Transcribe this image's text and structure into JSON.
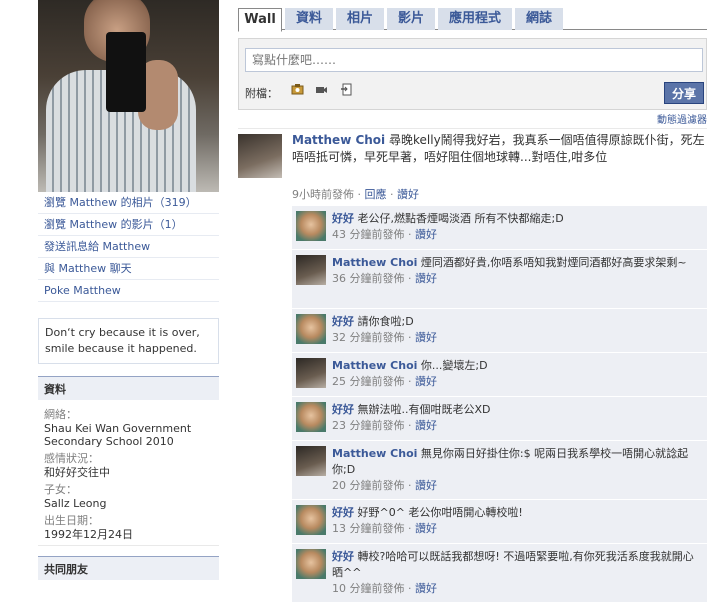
{
  "profile": {
    "links": [
      "瀏覽 Matthew 的相片（319）",
      "瀏覽 Matthew 的影片（1）",
      "發送訊息給 Matthew",
      "與 Matthew 聊天",
      "Poke Matthew"
    ],
    "bio": "Don‘t cry because it is over, smile because it happened.",
    "info": {
      "title": "資料",
      "network_label": "網絡：",
      "network_value": "Shau Kei Wan Government Secondary School 2010",
      "relationship_label": "感情狀況：",
      "relationship_value": "和好好交往中",
      "children_label": "子女：",
      "children_value": "Sallz Leong",
      "birthday_label": "出生日期：",
      "birthday_value": "1992年12月24日"
    },
    "friends_title": "共同朋友"
  },
  "tabs": [
    "Wall",
    "資料",
    "相片",
    "影片",
    "應用程式",
    "網誌"
  ],
  "composer": {
    "placeholder": "寫點什麼吧……",
    "attach_label": "附檔：",
    "share_label": "分享"
  },
  "filter_link": "動態過濾器",
  "post": {
    "author": "Matthew Choi",
    "text": "尋晚kelly鬧得我好岩，我真系一個唔值得原諒既仆街，死左唔唔抵可憐，早死早著，唔好阻住個地球轉...對唔住,咁多位",
    "time": "9小時前發佈",
    "reply": "回應",
    "like": "讚好"
  },
  "comments": [
    {
      "author": "好好",
      "text": "老公仔,燃點香煙喝淡酒 所有不快都縮走;D",
      "time": "43 分鐘前發佈",
      "like": "讚好",
      "avatar": "girl"
    },
    {
      "author": "Matthew Choi",
      "text": "煙同酒都好貴,你唔系唔知我對煙同酒都好高要求架剩~",
      "time": "36 分鐘前發佈",
      "like": "讚好",
      "avatar": "guy"
    },
    {
      "author": "好好",
      "text": "請你食啦;D",
      "time": "32 分鐘前發佈",
      "like": "讚好",
      "avatar": "girl"
    },
    {
      "author": "Matthew Choi",
      "text": "你...變壞左;D",
      "time": "25 分鐘前發佈",
      "like": "讚好",
      "avatar": "guy"
    },
    {
      "author": "好好",
      "text": "無辦法啦..有個咁既老公XD",
      "time": "23 分鐘前發佈",
      "like": "讚好",
      "avatar": "girl"
    },
    {
      "author": "Matthew Choi",
      "text": "無見你兩日好掛住你:$ 呢兩日我系學校一唔開心就諗起你;D",
      "time": "20 分鐘前發佈",
      "like": "讚好",
      "avatar": "guy"
    },
    {
      "author": "好好",
      "text": "好野^0^ 老公你咁唔開心轉校啦!",
      "time": "13 分鐘前發佈",
      "like": "讚好",
      "avatar": "girl"
    },
    {
      "author": "好好",
      "text": "轉校?哈哈可以既話我都想呀! 不過唔緊要啦,有你死我活系度我就開心晒^^",
      "time": "10 分鐘前發佈",
      "like": "讚好",
      "avatar": "girl"
    }
  ]
}
